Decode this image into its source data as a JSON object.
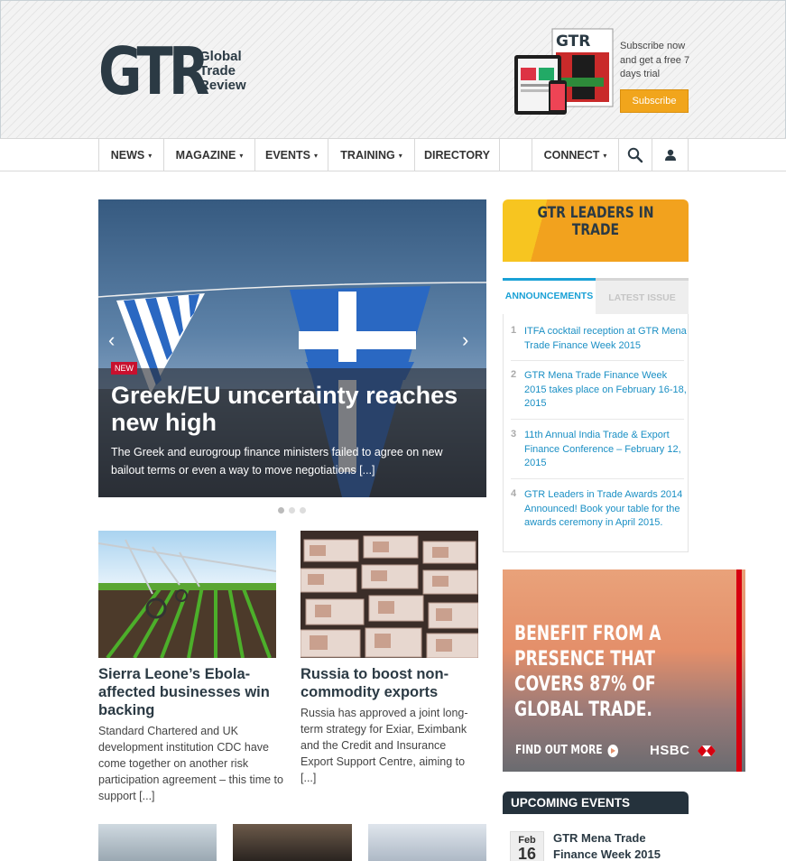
{
  "header": {
    "logo_mark": "GTR",
    "logo_line1": "Global",
    "logo_line2": "Trade",
    "logo_line3": "Review",
    "subscribe_text": "Subscribe now and get a free 7 days trial",
    "subscribe_button": "Subscribe",
    "magazine_cover_logo": "GTR"
  },
  "nav": {
    "items": [
      {
        "label": "NEWS",
        "dropdown": true
      },
      {
        "label": "MAGAZINE",
        "dropdown": true
      },
      {
        "label": "EVENTS",
        "dropdown": true
      },
      {
        "label": "TRAINING",
        "dropdown": true
      },
      {
        "label": "DIRECTORY",
        "dropdown": false
      },
      {
        "label": "",
        "dropdown": false
      },
      {
        "label": "CONNECT",
        "dropdown": true
      }
    ],
    "search_icon": "search-icon",
    "user_icon": "user-icon"
  },
  "hero": {
    "badge": "NEW",
    "title": "Greek/EU uncertainty reaches new high",
    "text": "The Greek and eurogroup finance ministers failed to agree on new bailout terms or even a way to move negotiations [...]",
    "slide_count": 3,
    "active_slide": 1
  },
  "articles": [
    {
      "title": "Sierra Leone’s Ebola-affected businesses win backing",
      "text": "Standard Chartered and UK development institution CDC have come together on another risk participation agreement – this time to support [...]"
    },
    {
      "title": "Russia to boost non-commodity exports",
      "text": "Russia has approved a joint long-term strategy for Exiar, Eximbank and the Credit and Insurance Export Support Centre, aiming to [...]"
    }
  ],
  "sidebar": {
    "leaders_banner": "GTR LEADERS IN TRADE",
    "tabs": [
      "ANNOUNCEMENTS",
      "LATEST ISSUE"
    ],
    "announcements": [
      {
        "num": "1",
        "text": "ITFA cocktail reception at GTR Mena Trade Finance Week 2015"
      },
      {
        "num": "2",
        "text": "GTR Mena Trade Finance Week 2015 takes place on February 16-18, 2015"
      },
      {
        "num": "3",
        "text": "11th Annual India Trade & Export Finance Conference – February 12, 2015"
      },
      {
        "num": "4",
        "text": "GTR Leaders in Trade Awards 2014 Announced! Book your table for the awards ceremony in April 2015."
      }
    ],
    "ad": {
      "headline": "BENEFIT FROM A PRESENCE THAT COVERS 87% OF GLOBAL TRADE.",
      "cta": "FIND OUT MORE",
      "brand": "HSBC"
    },
    "events_title": "UPCOMING EVENTS",
    "event": {
      "month": "Feb",
      "day": "16",
      "title": "GTR Mena Trade Finance Week 2015"
    }
  }
}
